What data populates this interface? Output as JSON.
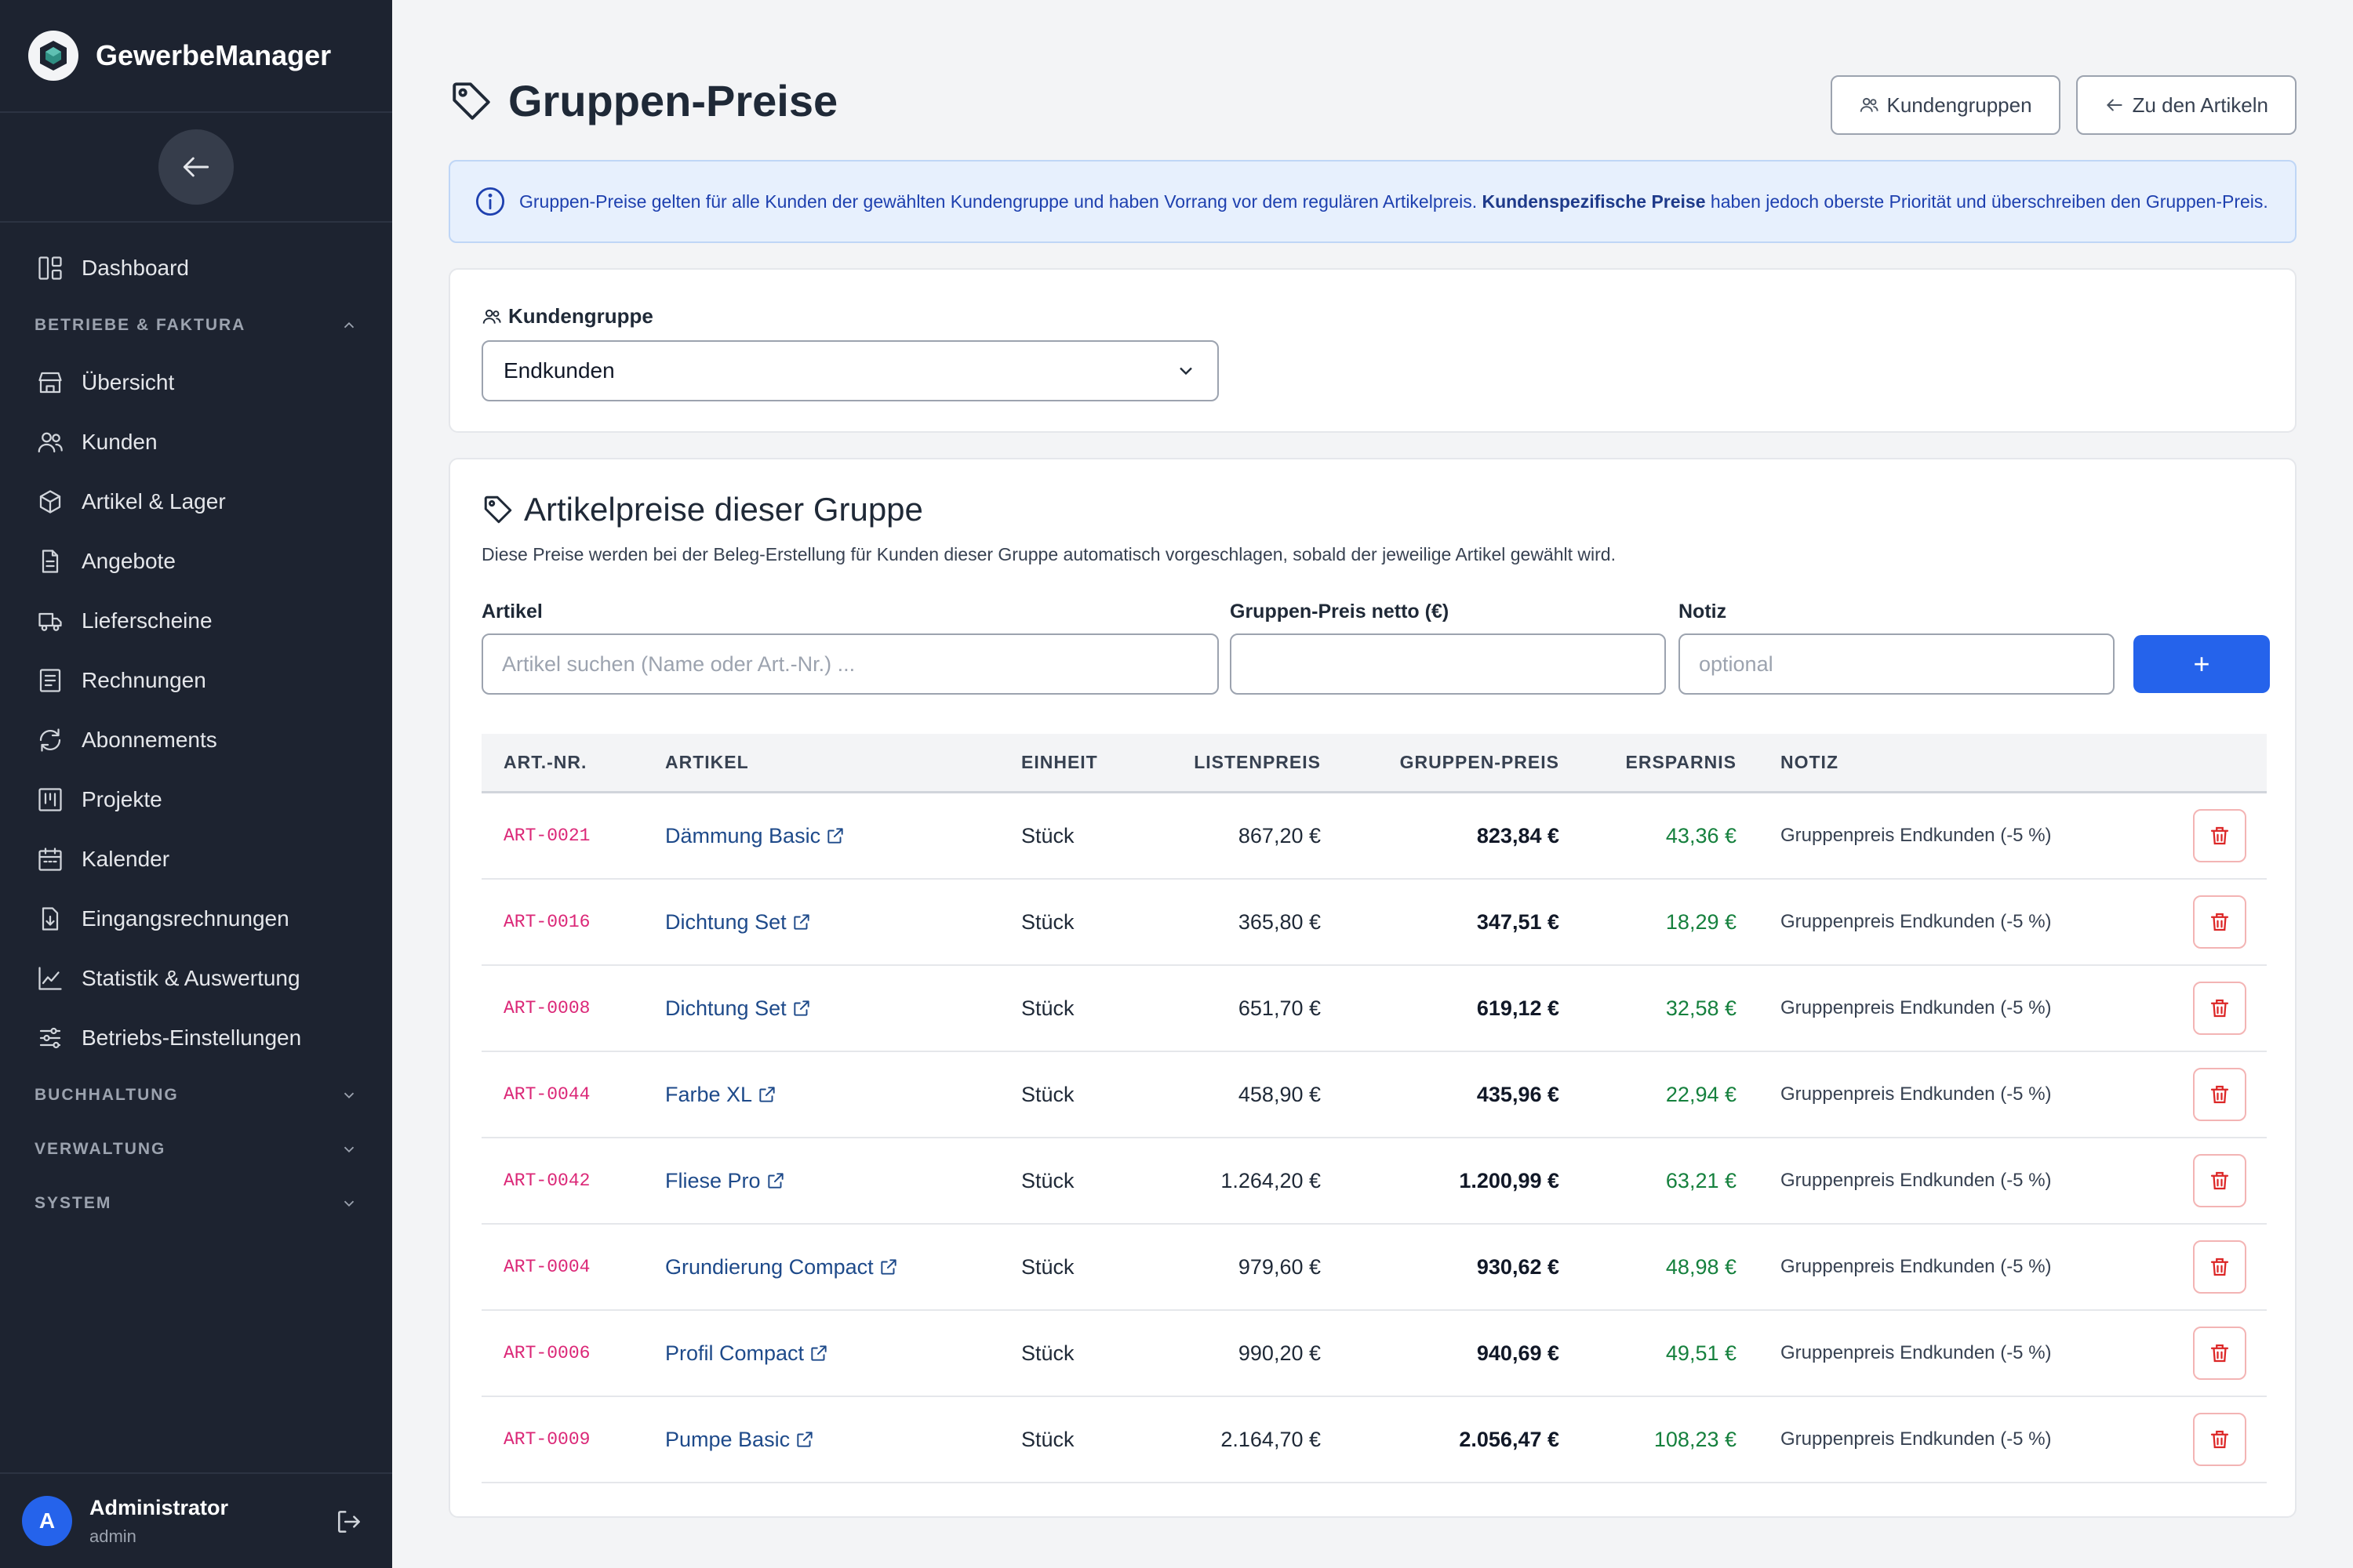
{
  "brand": {
    "name": "GewerbeManager"
  },
  "sidebar": {
    "dashboard": "Dashboard",
    "section_betriebe": "BETRIEBE & FAKTURA",
    "items": [
      {
        "label": "Übersicht",
        "icon": "store-icon"
      },
      {
        "label": "Kunden",
        "icon": "users-icon"
      },
      {
        "label": "Artikel & Lager",
        "icon": "box-icon"
      },
      {
        "label": "Angebote",
        "icon": "document-icon"
      },
      {
        "label": "Lieferscheine",
        "icon": "truck-icon"
      },
      {
        "label": "Rechnungen",
        "icon": "receipt-icon"
      },
      {
        "label": "Abonnements",
        "icon": "refresh-icon"
      },
      {
        "label": "Projekte",
        "icon": "kanban-icon"
      },
      {
        "label": "Kalender",
        "icon": "calendar-icon"
      },
      {
        "label": "Eingangsrechnungen",
        "icon": "file-download-icon"
      },
      {
        "label": "Statistik & Auswertung",
        "icon": "chart-line-icon"
      },
      {
        "label": "Betriebs-Einstellungen",
        "icon": "sliders-icon"
      }
    ],
    "section_buchhaltung": "BUCHHALTUNG",
    "section_verwaltung": "VERWALTUNG",
    "section_system": "SYSTEM"
  },
  "user": {
    "avatar_letter": "A",
    "name": "Administrator",
    "role": "admin"
  },
  "header": {
    "title": "Gruppen-Preise",
    "btn_groups": "Kundengruppen",
    "btn_articles": "Zu den Artikeln"
  },
  "info": {
    "text_before": "Gruppen-Preise gelten für alle Kunden der gewählten Kundengruppe und haben Vorrang vor dem regulären Artikelpreis. ",
    "text_bold": "Kundenspezifische Preise",
    "text_after": " haben jedoch oberste Priorität und überschreiben den Gruppen-Preis."
  },
  "group_select": {
    "label": "Kundengruppe",
    "value": "Endkunden"
  },
  "prices": {
    "title": "Artikelpreise dieser Gruppe",
    "description": "Diese Preise werden bei der Beleg-Erstellung für Kunden dieser Gruppe automatisch vorgeschlagen, sobald der jeweilige Artikel gewählt wird.",
    "form": {
      "article_label": "Artikel",
      "article_placeholder": "Artikel suchen (Name oder Art.-Nr.) ...",
      "price_label": "Gruppen-Preis netto (€)",
      "price_value": "",
      "note_label": "Notiz",
      "note_placeholder": "optional",
      "add_label": "+"
    },
    "columns": [
      "ART.-NR.",
      "ARTIKEL",
      "EINHEIT",
      "LISTENPREIS",
      "GRUPPEN-PREIS",
      "ERSPARNIS",
      "NOTIZ"
    ],
    "rows": [
      {
        "nr": "ART-0021",
        "name": "Dämmung Basic",
        "unit": "Stück",
        "list": "867,20 €",
        "group": "823,84 €",
        "save": "43,36 €",
        "note": "Gruppenpreis Endkunden (-5 %)"
      },
      {
        "nr": "ART-0016",
        "name": "Dichtung Set",
        "unit": "Stück",
        "list": "365,80 €",
        "group": "347,51 €",
        "save": "18,29 €",
        "note": "Gruppenpreis Endkunden (-5 %)"
      },
      {
        "nr": "ART-0008",
        "name": "Dichtung Set",
        "unit": "Stück",
        "list": "651,70 €",
        "group": "619,12 €",
        "save": "32,58 €",
        "note": "Gruppenpreis Endkunden (-5 %)"
      },
      {
        "nr": "ART-0044",
        "name": "Farbe XL",
        "unit": "Stück",
        "list": "458,90 €",
        "group": "435,96 €",
        "save": "22,94 €",
        "note": "Gruppenpreis Endkunden (-5 %)"
      },
      {
        "nr": "ART-0042",
        "name": "Fliese Pro",
        "unit": "Stück",
        "list": "1.264,20 €",
        "group": "1.200,99 €",
        "save": "63,21 €",
        "note": "Gruppenpreis Endkunden (-5 %)"
      },
      {
        "nr": "ART-0004",
        "name": "Grundierung Compact",
        "unit": "Stück",
        "list": "979,60 €",
        "group": "930,62 €",
        "save": "48,98 €",
        "note": "Gruppenpreis Endkunden (-5 %)"
      },
      {
        "nr": "ART-0006",
        "name": "Profil Compact",
        "unit": "Stück",
        "list": "990,20 €",
        "group": "940,69 €",
        "save": "49,51 €",
        "note": "Gruppenpreis Endkunden (-5 %)"
      },
      {
        "nr": "ART-0009",
        "name": "Pumpe Basic",
        "unit": "Stück",
        "list": "2.164,70 €",
        "group": "2.056,47 €",
        "save": "108,23 €",
        "note": "Gruppenpreis Endkunden (-5 %)"
      }
    ]
  },
  "colors": {
    "sidebar_bg": "#1d2330",
    "primary": "#2563eb",
    "savings": "#15803d",
    "article_nr": "#db2777",
    "delete": "#dc2626"
  }
}
